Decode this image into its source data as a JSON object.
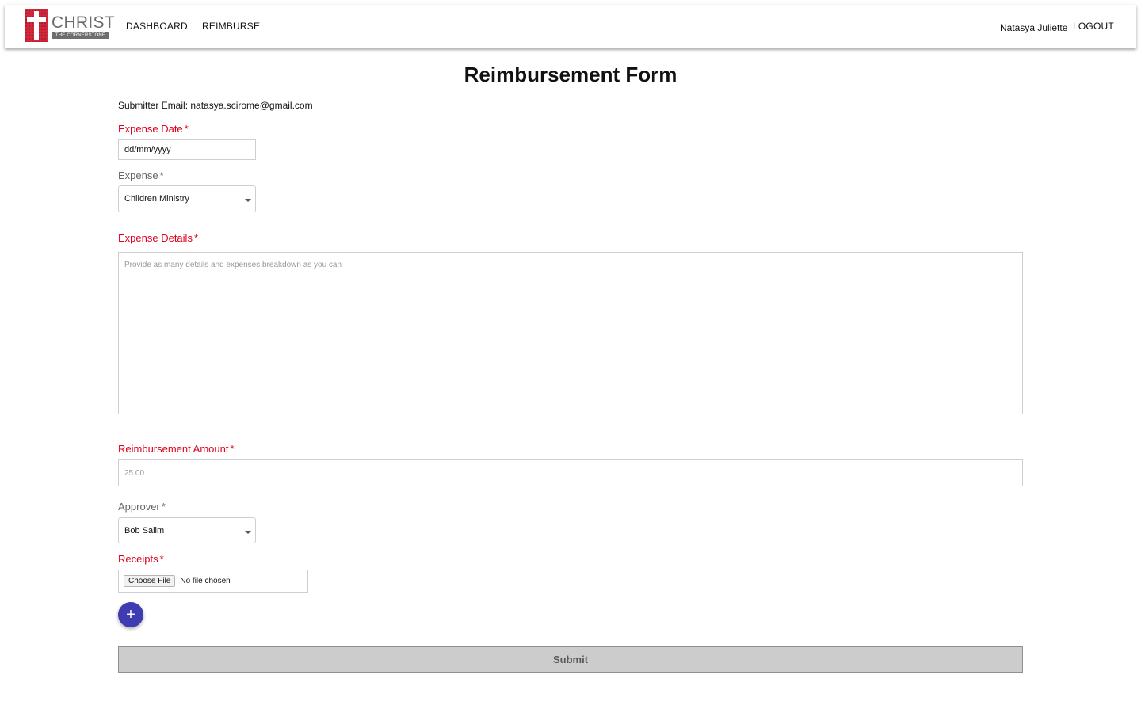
{
  "navbar": {
    "logo_text": "CHRIST",
    "logo_subtext": "THE CORNERSTONE",
    "links": [
      "DASHBOARD",
      "REIMBURSE"
    ],
    "user_name": "Natasya Juliette",
    "logout_label": "LOGOUT"
  },
  "form": {
    "title": "Reimbursement Form",
    "submitter_email": "Submitter Email: natasya.scirome@gmail.com",
    "expense_date": {
      "label": "Expense Date",
      "value": "dd/mm/yyyy"
    },
    "expense": {
      "label": "Expense",
      "selected": "Children Ministry"
    },
    "expense_details": {
      "label": "Expense Details",
      "placeholder": "Provide as many details and expenses breakdown as you can"
    },
    "reimbursement_amount": {
      "label": "Reimbursement Amount",
      "placeholder": "25.00"
    },
    "approver": {
      "label": "Approver",
      "selected": "Bob Salim"
    },
    "receipts": {
      "label": "Receipts",
      "button_label": "Choose File",
      "status": "No file chosen"
    },
    "add_button_symbol": "+",
    "submit_label": "Submit",
    "required_marker": "*"
  },
  "colors": {
    "required_label": "#e0001b",
    "fab": "#3f3bb0",
    "submit_bg": "#cccccc"
  },
  "icons": {
    "logo": "cross-logo-icon",
    "select_caret": "caret-down-icon",
    "add": "plus-icon"
  }
}
